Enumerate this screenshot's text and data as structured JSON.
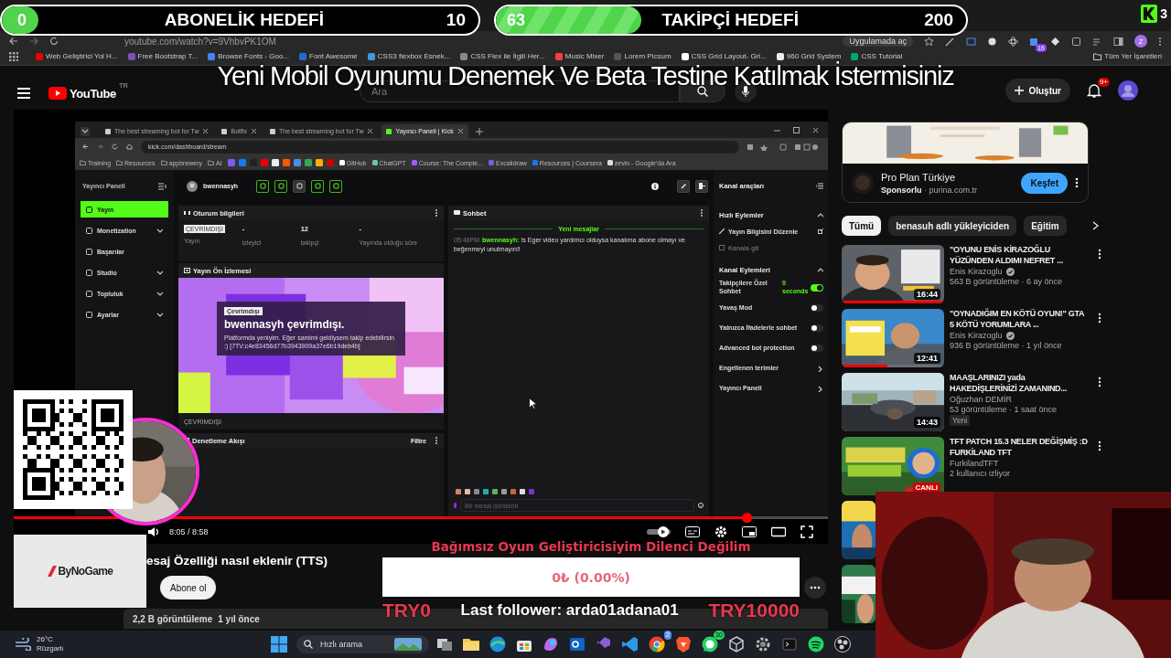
{
  "goals": [
    {
      "kind": "subscribers",
      "current": "0",
      "title": "ABONELİK HEDEFİ",
      "target": "10",
      "level": 0
    },
    {
      "kind": "followers",
      "current": "63",
      "title": "TAKİPÇİ HEDEFİ",
      "target": "200",
      "level": 0.31
    }
  ],
  "corner_count": "3",
  "stream_title": "Yeni Mobil Oyunumu Denemek Ve Beta Testine Katılmak İstermisiniz",
  "browser": {
    "url": "youtube.com/watch?v=9VhbvPK1OM",
    "open_in_app": "Uygulamada aç",
    "extension_badge": "16",
    "profile_initial": "Z",
    "bookmarks": [
      "Web Geliştirici Yol H...",
      "Free Bootstrap T...",
      "Browse Fonts - Goo...",
      "Font Awesome",
      "CSS3 flexbox Esnek...",
      "CSS Flex ile İlgili Her...",
      "Music Mixer",
      "Lorem Picsum",
      "CSS Grid Layout- Gri...",
      "960 Grid System",
      "CSS Tutorial"
    ],
    "all_bookmarks": "Tüm Yer İşaretleri"
  },
  "youtube": {
    "logo": "YouTube",
    "region": "TR",
    "search_placeholder": "Ara",
    "create": "Oluştur",
    "notifications": "9+"
  },
  "player": {
    "kick": {
      "tabs": [
        {
          "label": "The best streaming bot for Tw",
          "selected": false
        },
        {
          "label": "Botfix",
          "selected": false
        },
        {
          "label": "The best streaming bot for Tw",
          "selected": false
        },
        {
          "label": "Yayıncı Paneli | Kick",
          "selected": true
        }
      ],
      "url": "kick.com/dashboard/stream",
      "bookmark_folders": [
        "Training",
        "Resources",
        "appbrewery",
        "AI"
      ],
      "bookmarks": [
        "GitHub",
        "ChatGPT",
        "Course: The Comple...",
        "Excalidraw",
        "Resources | Coursera",
        "zevin - Google'da Ara"
      ],
      "nav_title": "Yayıncı Paneli",
      "nav": [
        {
          "label": "Yayın",
          "selected": true,
          "expandable": false
        },
        {
          "label": "Monetization",
          "selected": false,
          "expandable": true
        },
        {
          "label": "Başarılar",
          "selected": false,
          "expandable": false
        },
        {
          "label": "Studio",
          "selected": false,
          "expandable": true
        },
        {
          "label": "Topluluk",
          "selected": false,
          "expandable": true
        },
        {
          "label": "Ayarlar",
          "selected": false,
          "expandable": true
        }
      ],
      "channel": "bwennasyh",
      "session": {
        "title": "Oturum bilgileri",
        "stats": [
          {
            "kind": "badge",
            "value": "ÇEVRİMDIŞI",
            "label": "Yayın"
          },
          {
            "kind": "text",
            "value": "-",
            "label": "izleyici"
          },
          {
            "kind": "text",
            "value": "12",
            "label": "takipçi"
          },
          {
            "kind": "text",
            "value": "-",
            "label": "Yayında olduğu süre"
          }
        ]
      },
      "preview": {
        "title": "Yayın Ön İzlemesi",
        "badge": "Çevrimdışı",
        "heading": "bwennasyh çevrimdışı.",
        "message": "Platformda yeniyim. Eğer samimi geldiysem takip edebilirsin :) [7TV:c4e83456d77b3943909a37e6b19deb4b]",
        "status": "ÇEVRİMDIŞI"
      },
      "moderation": {
        "title": "Denetleme Akışı",
        "filter": "Filtre"
      },
      "chat": {
        "title": "Sohbet",
        "divider": "Yeni mesajlar",
        "messages": [
          {
            "time": "05:46PM",
            "user": "bwennasyh:",
            "text": "!s Eger video yardımcı olduysa kanalıma abone olmayı ve beğenmeyi unutmayın!!"
          }
        ],
        "placeholder": "Bir mesaj gönderin"
      },
      "tools": {
        "title": "Kanal araçları",
        "quick_title": "Hızlı Eylemler",
        "quick": [
          {
            "label": "Yayın Bilgisini Düzenle",
            "disabled": false
          },
          {
            "label": "Kanala git",
            "disabled": true
          }
        ],
        "channel_title": "Kanal Eylemleri",
        "settings": [
          {
            "kind": "toggle",
            "label": "Takipçilere Özel Sohbet",
            "value": "0 seconds",
            "on": true
          },
          {
            "kind": "toggle",
            "label": "Yavaş Mod",
            "on": false
          },
          {
            "kind": "toggle",
            "label": "Yalnızca İfadelerle sohbet",
            "on": false
          },
          {
            "kind": "toggle",
            "label": "Advanced bot protection",
            "on": false
          },
          {
            "kind": "link",
            "label": "Engellenen terimler"
          },
          {
            "kind": "link",
            "label": "Yayıncı Paneli"
          }
        ]
      }
    },
    "time": "8:05 / 8:58",
    "level": 0.9,
    "title": "esaj Özelliği nasıl eklenir (TTS)",
    "subscribe": "Abone ol",
    "views": "2,2 B görüntüleme",
    "age": "1 yıl önce"
  },
  "sidebar": {
    "ad": {
      "name": "Pro Plan Türkiye",
      "sponsor": "Sponsorlu",
      "domain": "· purina.com.tr",
      "action": "Keşfet"
    },
    "chips": [
      {
        "label": "Tümü",
        "selected": true
      },
      {
        "label": "benasuh adlı yükleyiciden",
        "selected": false
      },
      {
        "label": "Eğitim",
        "selected": false
      }
    ],
    "videos": [
      {
        "title": "\"OYUNU ENİS KİRAZOĞLU YÜZÜNDEN ALDIMI NEFRET ...",
        "channel": "Enis Kirazoglu",
        "verified": true,
        "meta": "563 B görüntüleme · 6 ay önce",
        "duration": "16:44",
        "level": 1
      },
      {
        "title": "\"OYNADIĞIM EN KÖTÜ OYUN!\" GTA 5 KÖTÜ YORUMLARA ...",
        "channel": "Enis Kirazoglu",
        "verified": true,
        "meta": "936 B görüntüleme · 1 yıl önce",
        "duration": "12:41",
        "level": 0.45
      },
      {
        "title": "MAAŞLARINIZI yada HAKEDİŞLERİNİZİ ZAMANIND...",
        "channel": "Oğuzhan DEMİR",
        "verified": false,
        "meta": "53 görüntüleme · 1 saat önce",
        "duration": "14:43",
        "badge": "Yeni"
      },
      {
        "title": "TFT PATCH 15.3 NELER DEĞİŞMİŞ :D FURKİLAND TFT",
        "channel": "FurkilandTFT",
        "verified": false,
        "meta": "2 kullanıcı izliyor",
        "live": "CANLI"
      }
    ]
  },
  "sponsor_logo": "ByNoGame",
  "donation": {
    "title": "Bağımsız Oyun Geliştiricisiyim Dilenci Değilim",
    "amount": "0₺ (0.00%)",
    "level": 0,
    "min": "TRY0",
    "max": "TRY10000",
    "last_follower": "Last follower: arda01adana01"
  },
  "taskbar": {
    "temperature": "26°C",
    "condition": "Rüzgarlı",
    "search": "Hızlı arama",
    "apps": [
      {
        "kind": "taskview"
      },
      {
        "kind": "folder"
      },
      {
        "kind": "edge"
      },
      {
        "kind": "store"
      },
      {
        "kind": "copilot"
      },
      {
        "kind": "outlook"
      },
      {
        "kind": "vs"
      },
      {
        "kind": "vscode"
      },
      {
        "kind": "chrome",
        "badge": "2"
      },
      {
        "kind": "brave"
      },
      {
        "kind": "whatsapp",
        "badge": "30"
      },
      {
        "kind": "cube"
      },
      {
        "kind": "gear"
      },
      {
        "kind": "terminal"
      },
      {
        "kind": "spotify"
      },
      {
        "kind": "obs"
      }
    ]
  }
}
